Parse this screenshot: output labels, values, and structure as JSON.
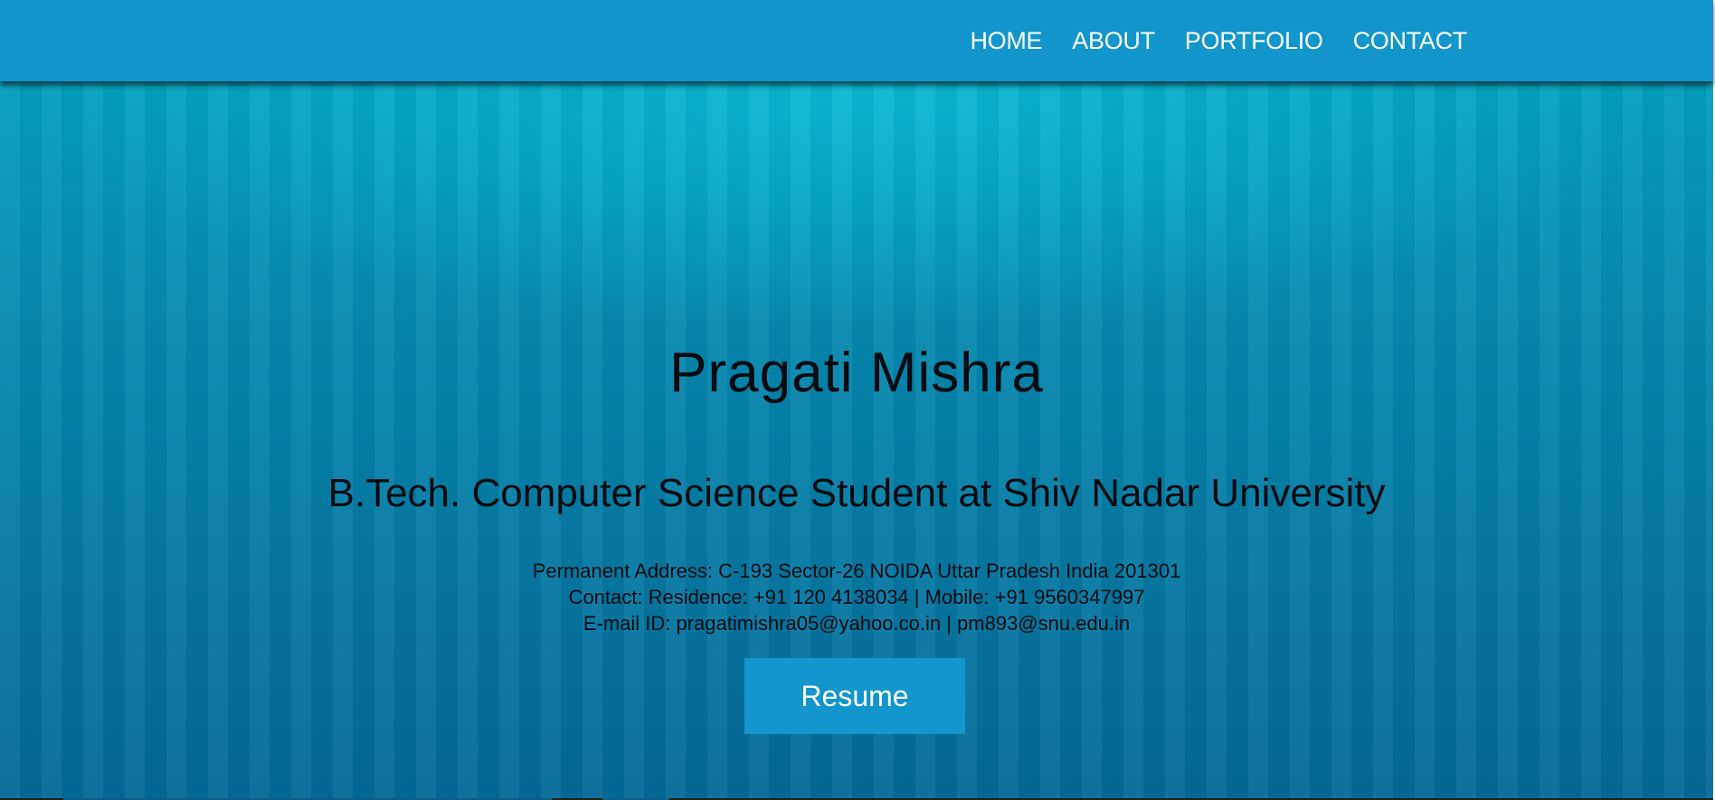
{
  "nav": {
    "items": [
      {
        "label": "HOME"
      },
      {
        "label": "ABOUT"
      },
      {
        "label": "PORTFOLIO"
      },
      {
        "label": "CONTACT"
      }
    ]
  },
  "hero": {
    "name": "Pragati Mishra",
    "subtitle": "B.Tech. Computer Science Student at Shiv Nadar University",
    "address": "Permanent Address: C-193 Sector-26 NOIDA Uttar Pradesh India 201301",
    "contact": "Contact: Residence: +91 120 4138034 | Mobile: +91 9560347997",
    "email": "E-mail ID: pragatimishra05@yahoo.co.in | pm893@snu.edu.in",
    "resume_label": "Resume"
  },
  "colors": {
    "navbar": "#1296cb",
    "button": "#1296cb",
    "background_top": "#03a7c5",
    "background_bottom": "#066a98",
    "text": "#050b10"
  }
}
